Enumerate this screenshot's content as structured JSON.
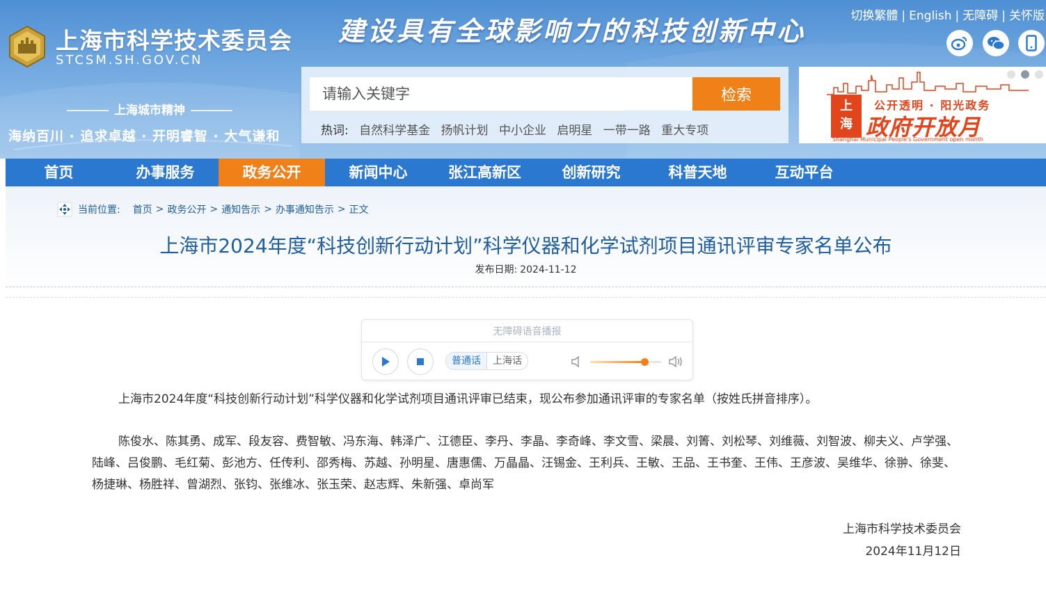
{
  "header": {
    "site_name": "上海市科学技术委员会",
    "site_domain": "STCSM.SH.GOV.CN",
    "slogan": "建设具有全球影响力的科技创新中心",
    "spirit_title": "上海城市精神",
    "spirit_text": "海纳百川 · 追求卓越 · 开明睿智 · 大气谦和",
    "top_links": {
      "traditional": "切换繁體",
      "english": "English",
      "accessible": "无障碍",
      "care": "关怀版",
      "separator": "|"
    },
    "social_icons": [
      "weibo-icon",
      "wechat-icon",
      "mobile-icon"
    ]
  },
  "search": {
    "placeholder": "请输入关键字",
    "button_label": "检索",
    "hotwords_label": "热词:",
    "hotwords": [
      "自然科学基金",
      "扬帆计划",
      "中小企业",
      "启明星",
      "一带一路",
      "重大专项"
    ]
  },
  "banner": {
    "seal_text_1": "上",
    "seal_text_2": "海",
    "subtitle": "公开透明 · 阳光政务",
    "title": "政府开放月",
    "english": "Shanghai Municipal People's Government open month",
    "dots": 3,
    "active_dot": 1
  },
  "nav": {
    "items": [
      "首页",
      "办事服务",
      "政务公开",
      "新闻中心",
      "张江高新区",
      "创新研究",
      "科普天地",
      "互动平台"
    ],
    "active_index": 2
  },
  "breadcrumb": {
    "label": "当前位置:",
    "items": [
      "首页",
      "政务公开",
      "通知告示",
      "办事通知告示",
      "正文"
    ],
    "separator": ">"
  },
  "article": {
    "title": "上海市2024年度“科技创新行动计划”科学仪器和化学试剂项目通讯评审专家名单公布",
    "date_label": "发布日期:",
    "date": "2024-11-12",
    "paragraph1": "上海市2024年度“科技创新行动计划”科学仪器和化学试剂项目通讯评审已结束，现公布参加通讯评审的专家名单（按姓氏拼音排序）。",
    "paragraph2": "陈俊水、陈其勇、成军、段友容、费智敏、冯东海、韩泽广、江德臣、李丹、李晶、李奇峰、李文雪、梁晨、刘箐、刘松琴、刘维薇、刘智波、柳夫义、卢学强、陆峰、吕俊鹏、毛红菊、彭池方、任传利、邵秀梅、苏越、孙明星、唐惠儒、万晶晶、汪锡金、王利兵、王敏、王品、王书奎、王伟、王彦波、吴维华、徐翀、徐斐、杨捷琳、杨胜祥、曾湖烈、张钧、张维冰、张玉荣、赵志辉、朱新强、卓尚军",
    "signature_org": "上海市科学技术委员会",
    "signature_date": "2024年11月12日"
  },
  "audio_player": {
    "title": "无障碍语音播报",
    "lang_mandarin": "普通话",
    "lang_shanghainese": "上海话",
    "volume": 0.76
  },
  "colors": {
    "nav_blue": "#2b78d0",
    "accent_orange": "#f08119",
    "title_blue": "#1f5d9c",
    "banner_red": "#e0451c"
  }
}
